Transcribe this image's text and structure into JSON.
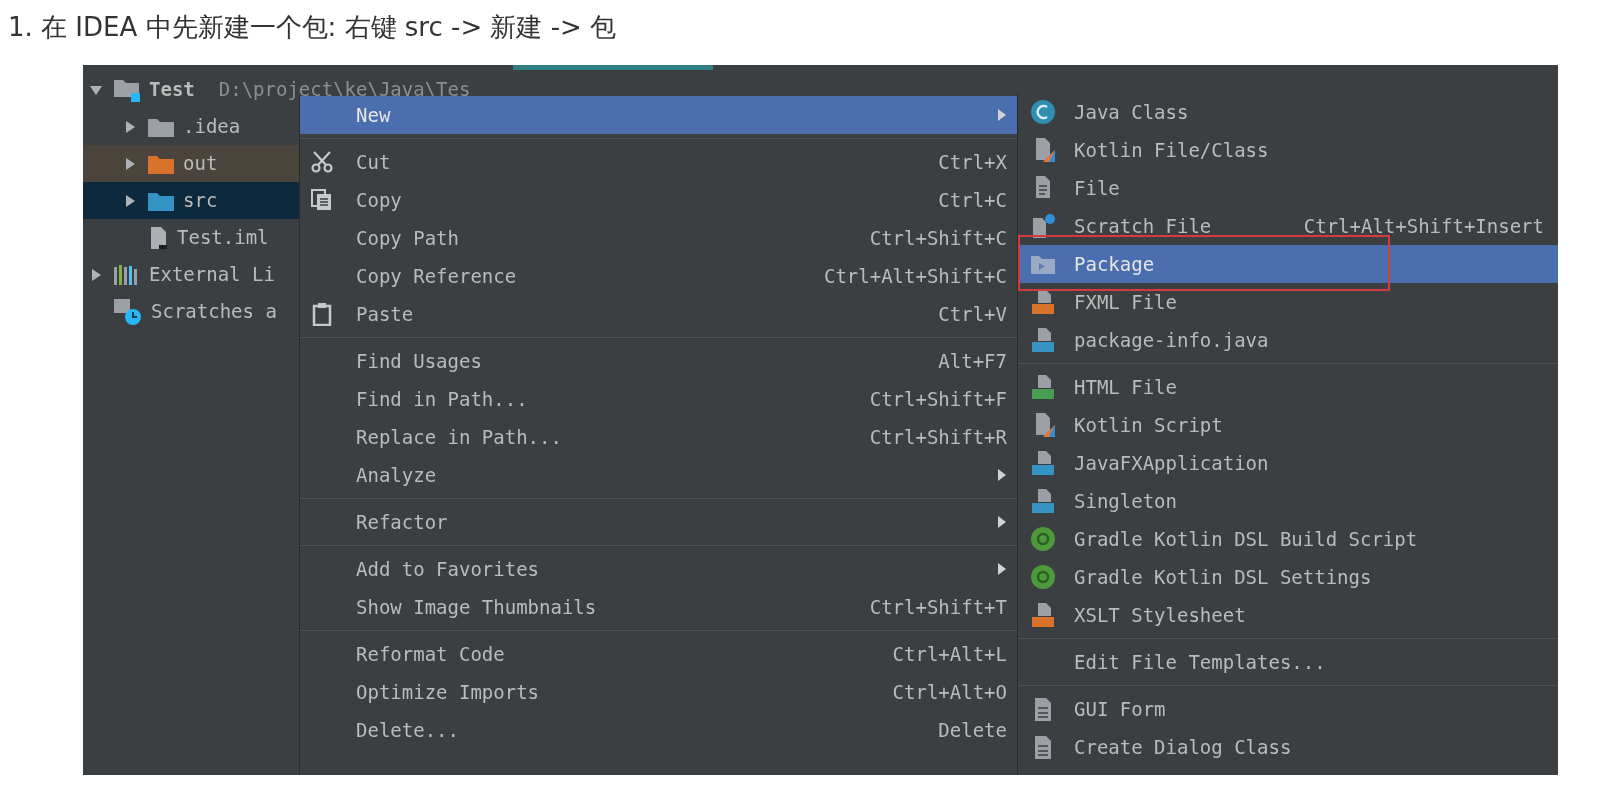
{
  "heading": "1. 在 IDEA 中先新建一个包: 右键 src -> 新建 -> 包",
  "tree": [
    {
      "kind": "project",
      "label": "Test",
      "path": "D:\\project\\ke\\Java\\Tes",
      "expanded": true,
      "selected": false,
      "children": [
        {
          "kind": "folder",
          "label": ".idea",
          "color": "#9aa0a6",
          "expanded": false,
          "selected": false,
          "excluded": false
        },
        {
          "kind": "folder",
          "label": "out",
          "color": "#d9722b",
          "expanded": false,
          "selected": false,
          "excluded": true
        },
        {
          "kind": "folder",
          "label": "src",
          "color": "#3592c4",
          "expanded": false,
          "selected": true,
          "excluded": false
        },
        {
          "kind": "file",
          "label": "Test.iml",
          "selected": false,
          "excluded": false
        }
      ]
    },
    {
      "kind": "library",
      "label": "External Li",
      "expanded": false,
      "selected": false
    },
    {
      "kind": "scratches",
      "label": "Scratches a",
      "selected": false
    }
  ],
  "context_menu": [
    [
      {
        "kind": "submenu",
        "label": "New",
        "selected": true
      }
    ],
    [
      {
        "kind": "cut",
        "label": "Cut",
        "shortcut": "Ctrl+X",
        "selected": false
      },
      {
        "kind": "copy",
        "label": "Copy",
        "shortcut": "Ctrl+C",
        "selected": false
      },
      {
        "kind": "action",
        "label": "Copy Path",
        "shortcut": "Ctrl+Shift+C",
        "selected": false
      },
      {
        "kind": "action",
        "label": "Copy Reference",
        "shortcut": "Ctrl+Alt+Shift+C",
        "selected": false
      },
      {
        "kind": "paste",
        "label": "Paste",
        "shortcut": "Ctrl+V",
        "selected": false
      }
    ],
    [
      {
        "kind": "action",
        "label": "Find Usages",
        "shortcut": "Alt+F7",
        "selected": false
      },
      {
        "kind": "action",
        "label": "Find in Path...",
        "shortcut": "Ctrl+Shift+F",
        "selected": false
      },
      {
        "kind": "action",
        "label": "Replace in Path...",
        "shortcut": "Ctrl+Shift+R",
        "selected": false
      },
      {
        "kind": "submenu",
        "label": "Analyze",
        "selected": false
      }
    ],
    [
      {
        "kind": "submenu",
        "label": "Refactor",
        "selected": false
      }
    ],
    [
      {
        "kind": "submenu",
        "label": "Add to Favorites",
        "selected": false
      },
      {
        "kind": "action",
        "label": "Show Image Thumbnails",
        "shortcut": "Ctrl+Shift+T",
        "selected": false
      }
    ],
    [
      {
        "kind": "action",
        "label": "Reformat Code",
        "shortcut": "Ctrl+Alt+L",
        "selected": false
      },
      {
        "kind": "action",
        "label": "Optimize Imports",
        "shortcut": "Ctrl+Alt+O",
        "selected": false
      },
      {
        "kind": "action",
        "label": "Delete...",
        "shortcut": "Delete",
        "selected": false
      }
    ]
  ],
  "new_submenu": [
    [
      {
        "kind": "class",
        "label": "Java Class",
        "selected": false,
        "outlined": false
      },
      {
        "kind": "kotlin",
        "label": "Kotlin File/Class",
        "selected": false,
        "outlined": false
      },
      {
        "kind": "file",
        "label": "File",
        "selected": false,
        "outlined": false
      },
      {
        "kind": "scratch",
        "label": "Scratch File",
        "shortcut": "Ctrl+Alt+Shift+Insert",
        "selected": false,
        "outlined": false
      },
      {
        "kind": "package",
        "label": "Package",
        "selected": true,
        "outlined": true
      },
      {
        "kind": "template",
        "color": "#d9722b",
        "label": "FXML File",
        "selected": false,
        "outlined": false
      },
      {
        "kind": "template",
        "color": "#3592c4",
        "label": "package-info.java",
        "selected": false,
        "outlined": false
      }
    ],
    [
      {
        "kind": "template",
        "color": "#499c54",
        "label": "HTML File",
        "selected": false,
        "outlined": false
      },
      {
        "kind": "kotlin",
        "label": "Kotlin Script",
        "selected": false,
        "outlined": false
      },
      {
        "kind": "template",
        "color": "#3592c4",
        "label": "JavaFXApplication",
        "selected": false,
        "outlined": false
      },
      {
        "kind": "template",
        "color": "#3592c4",
        "label": "Singleton",
        "selected": false,
        "outlined": false
      },
      {
        "kind": "gradle",
        "label": "Gradle Kotlin DSL Build Script",
        "selected": false,
        "outlined": false
      },
      {
        "kind": "gradle",
        "label": "Gradle Kotlin DSL Settings",
        "selected": false,
        "outlined": false
      },
      {
        "kind": "template",
        "color": "#d9722b",
        "label": "XSLT Stylesheet",
        "selected": false,
        "outlined": false
      }
    ],
    [
      {
        "kind": "plain",
        "label": "Edit File Templates...",
        "selected": false,
        "outlined": false
      }
    ],
    [
      {
        "kind": "form",
        "label": "GUI Form",
        "selected": false,
        "outlined": false
      },
      {
        "kind": "form",
        "label": "Create Dialog Class",
        "selected": false,
        "outlined": false
      }
    ]
  ]
}
